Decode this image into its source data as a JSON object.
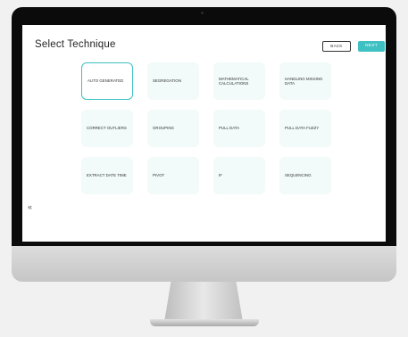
{
  "page": {
    "title": "Select Technique",
    "back_label": "BACK",
    "next_label": "NEXT",
    "collapse_glyph": "«"
  },
  "techniques": [
    {
      "label": "AUTO GENERATED",
      "selected": true
    },
    {
      "label": "SEGREGATION"
    },
    {
      "label": "MATHEMATICAL CALCULATIONS"
    },
    {
      "label": "HANDLING MISSING DATA"
    },
    {
      "label": "CORRECT OUTLIERS"
    },
    {
      "label": "GROUPING"
    },
    {
      "label": "PULL DATA"
    },
    {
      "label": "PULL DATA FUZZY"
    },
    {
      "label": "EXTRACT DATE TIME"
    },
    {
      "label": "PIVOT"
    },
    {
      "label": "IF"
    },
    {
      "label": "SEQUENCING"
    }
  ],
  "colors": {
    "accent": "#3fc1c3",
    "card_bg": "#f2fafa",
    "bezel": "#0b0b0b",
    "background": "#f1f1f1"
  }
}
